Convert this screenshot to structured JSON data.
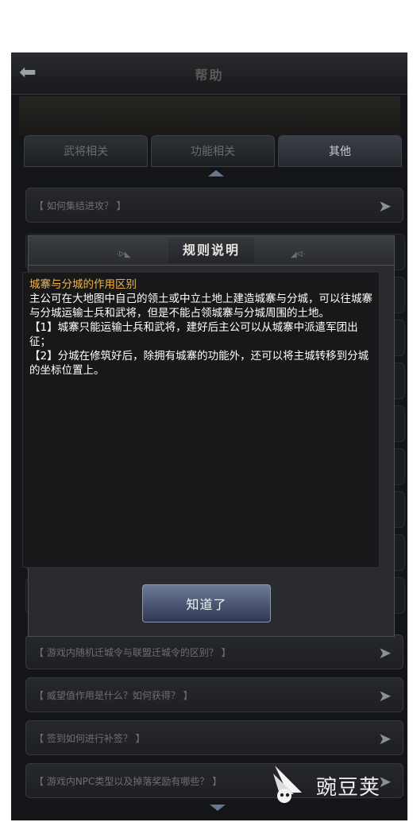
{
  "header": {
    "back_icon": "arrow-left-icon",
    "title": "帮助"
  },
  "tabs": [
    {
      "label": "武将相关",
      "active": false
    },
    {
      "label": "功能相关",
      "active": false
    },
    {
      "label": "其他",
      "active": true
    }
  ],
  "faq_items": [
    "【 如何集结进攻？ 】",
    "【 游戏内随机迁城令与联盟迁城令的区别？ 】",
    "【 威望值作用是什么？如何获得？ 】",
    "【 签到如何进行补签？ 】",
    "【 游戏内NPC类型以及掉落奖励有哪些？ 】"
  ],
  "dialog": {
    "title": "规则说明",
    "heading": "城寨与分城的作用区别",
    "paragraphs": [
      "主公可在大地图中自己的领土或中立土地上建造城寨与分城，可以往城寨与分城运输士兵和武将，但是不能占领城寨与分城周围的土地。",
      "【1】城寨只能运输士兵和武将，建好后主公可以从城寨中派遣军团出征；",
      "【2】分城在修筑好后，除拥有城寨的功能外，还可以将主城转移到分城的坐标位置上。"
    ],
    "ok_button": "知道了"
  },
  "watermark": {
    "text": "豌豆荚"
  },
  "colors": {
    "heading": "#f0b44d",
    "dialog_bg": "#2a2b2e",
    "button": "#4a5572"
  }
}
